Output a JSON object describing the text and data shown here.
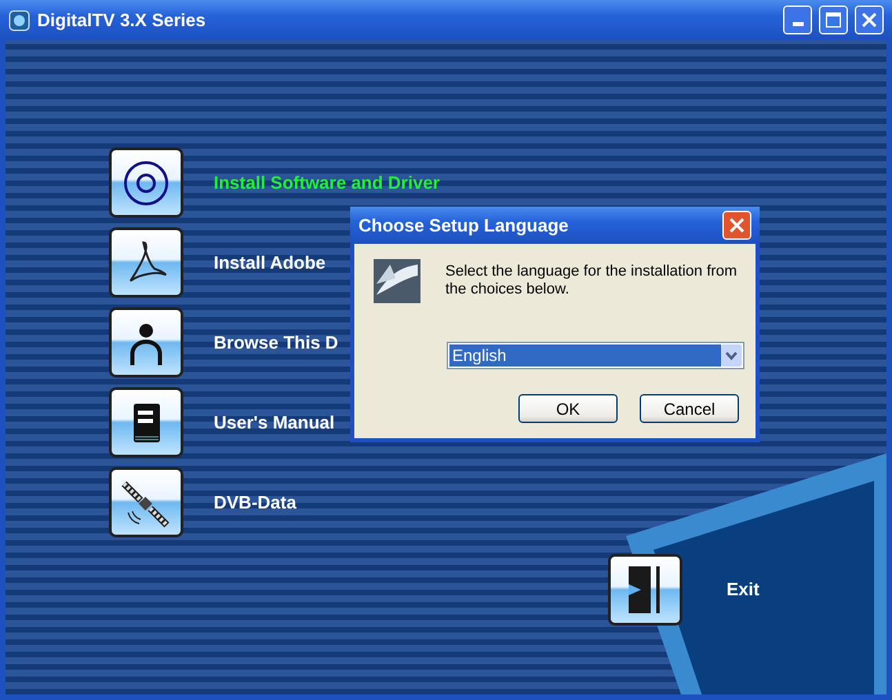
{
  "window": {
    "title": "DigitalTV 3.X Series"
  },
  "menu": [
    {
      "kind": "disc",
      "label": "Install Software and Driver",
      "highlighted": true
    },
    {
      "kind": "pdf",
      "label": "Install Adobe",
      "highlighted": false
    },
    {
      "kind": "person",
      "label": "Browse This D",
      "highlighted": false
    },
    {
      "kind": "book",
      "label": "User's Manual",
      "highlighted": false
    },
    {
      "kind": "satellite",
      "label": "DVB-Data",
      "highlighted": false
    }
  ],
  "exit": {
    "label": "Exit"
  },
  "dialog": {
    "title": "Choose Setup Language",
    "message": "Select the language for the installation from the choices below.",
    "language": {
      "value": "English"
    },
    "buttons": [
      "OK",
      "Cancel"
    ]
  }
}
